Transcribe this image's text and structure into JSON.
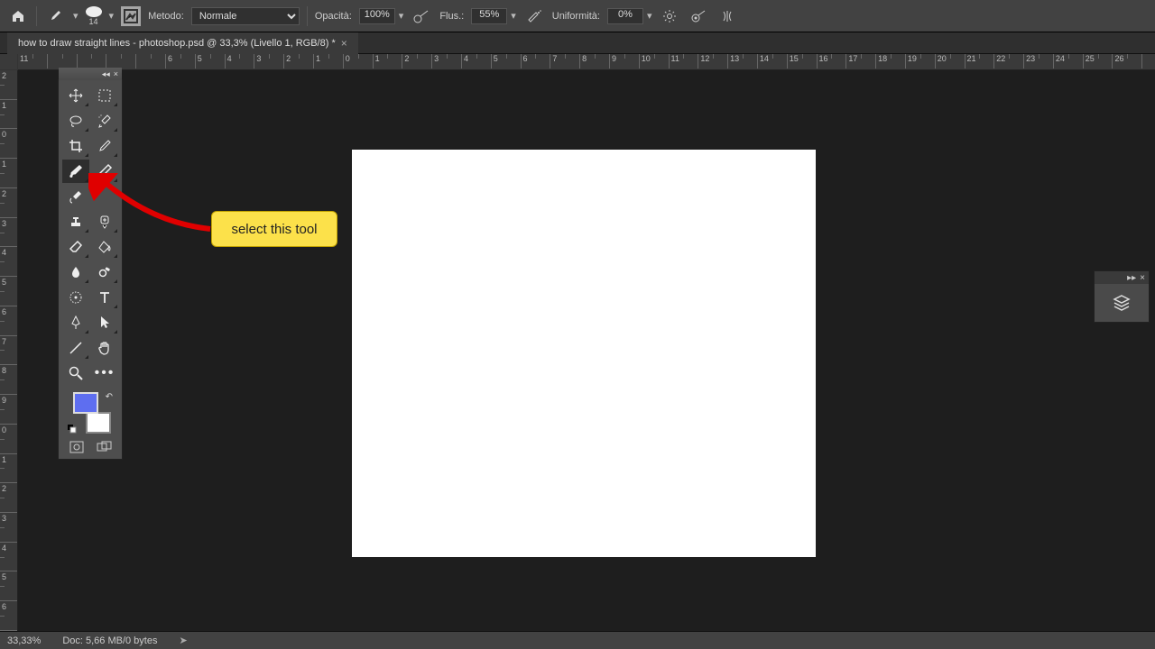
{
  "options_bar": {
    "brush_size": "14",
    "metodo_label": "Metodo:",
    "metodo_value": "Normale",
    "opacita_label": "Opacità:",
    "opacita_value": "100%",
    "flusso_label": "Flus.:",
    "flusso_value": "55%",
    "uniformita_label": "Uniformità:",
    "uniformita_value": "0%"
  },
  "tab": {
    "title": "how to draw straight lines - photoshop.psd @ 33,3% (Livello 1, RGB/8) *"
  },
  "ruler_h": [
    "11",
    "",
    "",
    "",
    "",
    "6",
    "5",
    "4",
    "3",
    "2",
    "1",
    "0",
    "1",
    "2",
    "3",
    "4",
    "5",
    "6",
    "7",
    "8",
    "9",
    "10",
    "11",
    "12",
    "13",
    "14",
    "15",
    "16",
    "17",
    "18",
    "19",
    "20",
    "21",
    "22",
    "23",
    "24",
    "25",
    "26"
  ],
  "ruler_v": [
    "2",
    "1",
    "0",
    "1",
    "2",
    "3",
    "4",
    "5",
    "6",
    "7",
    "8",
    "9",
    "0",
    "1",
    "2",
    "3",
    "4",
    "5",
    "6"
  ],
  "callout_text": "select this tool",
  "colors": {
    "foreground": "#5e6ef0",
    "background": "#ffffff"
  },
  "status": {
    "zoom": "33,33%",
    "doc": "Doc: 5,66 MB/0 bytes"
  }
}
